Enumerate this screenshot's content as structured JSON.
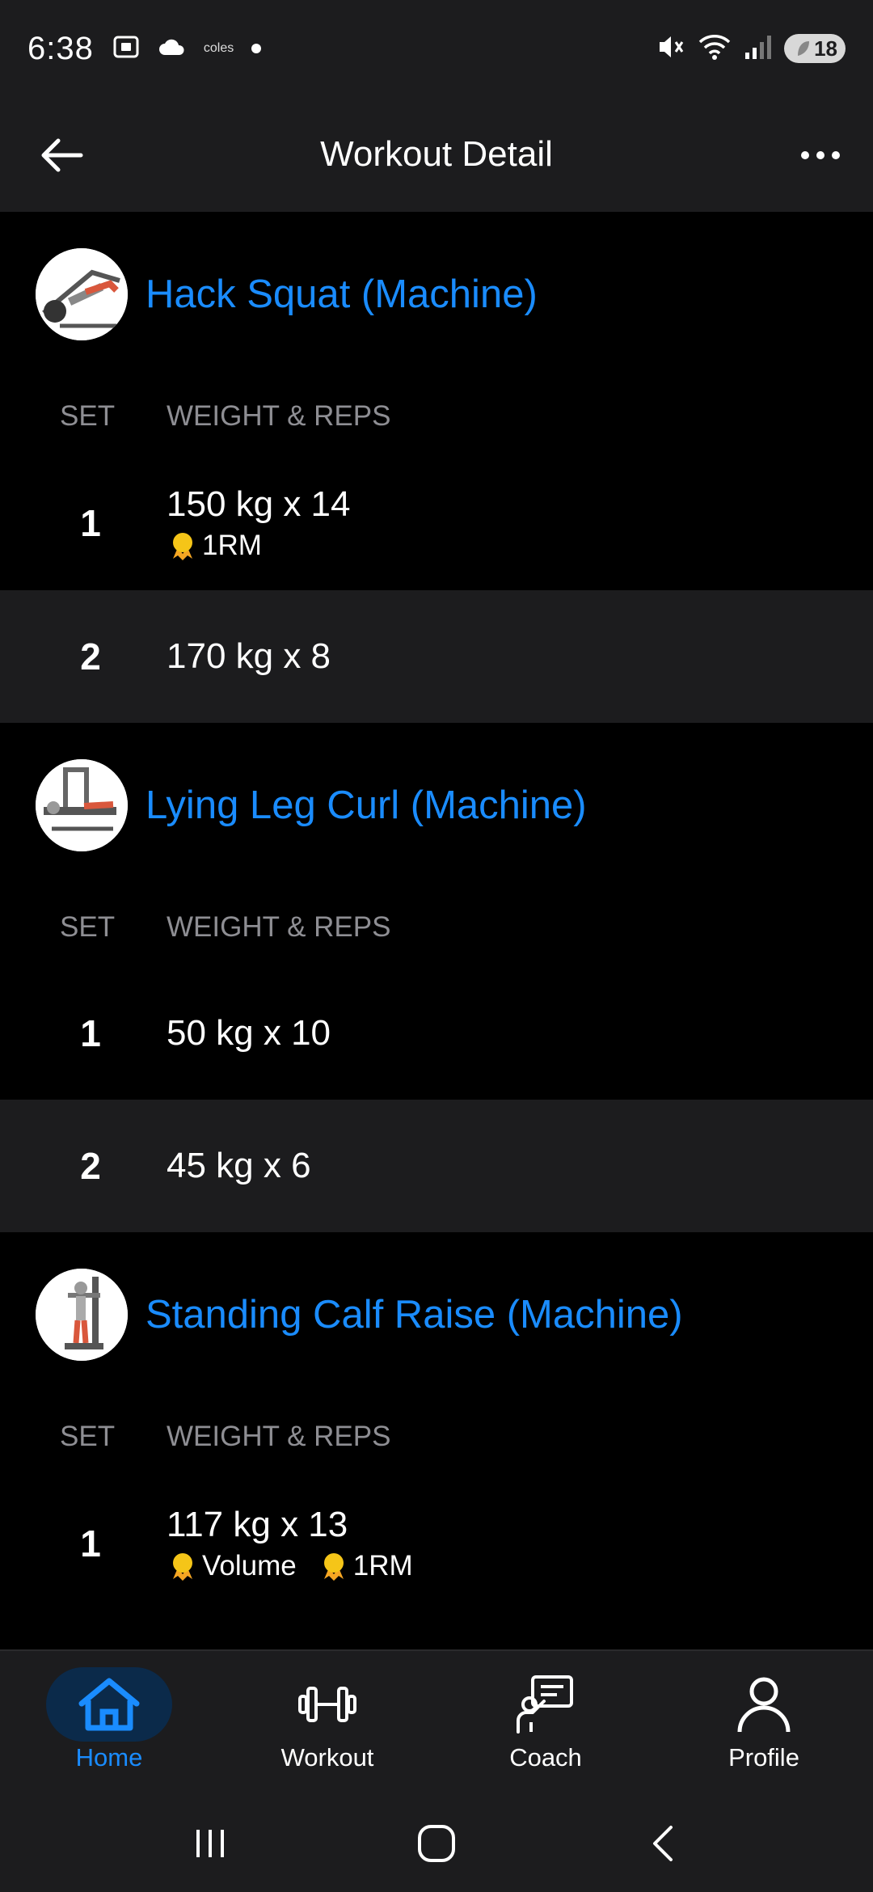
{
  "status_bar": {
    "time": "6:38",
    "app_text": "coles",
    "battery": "18"
  },
  "app_bar": {
    "title": "Workout Detail"
  },
  "column_headers": {
    "set": "SET",
    "weight_reps": "WEIGHT & REPS"
  },
  "exercises": [
    {
      "name": "Hack Squat (Machine)",
      "sets": [
        {
          "num": "1",
          "value": "150 kg x 14",
          "badges": [
            "1RM"
          ]
        },
        {
          "num": "2",
          "value": "170 kg x 8",
          "badges": []
        }
      ]
    },
    {
      "name": "Lying Leg Curl (Machine)",
      "sets": [
        {
          "num": "1",
          "value": "50 kg x 10",
          "badges": []
        },
        {
          "num": "2",
          "value": "45 kg x 6",
          "badges": []
        }
      ]
    },
    {
      "name": "Standing Calf Raise (Machine)",
      "sets": [
        {
          "num": "1",
          "value": "117 kg x 13",
          "badges": [
            "Volume",
            "1RM"
          ]
        }
      ]
    }
  ],
  "bottom_nav": [
    {
      "label": "Home",
      "icon": "home-icon",
      "active": true
    },
    {
      "label": "Workout",
      "icon": "dumbbell-icon",
      "active": false
    },
    {
      "label": "Coach",
      "icon": "coach-icon",
      "active": false
    },
    {
      "label": "Profile",
      "icon": "profile-icon",
      "active": false
    }
  ],
  "colors": {
    "accent": "#1a8cff",
    "background": "#000000",
    "surface": "#1c1c1e",
    "badge_gold": "#f5c518",
    "muted_text": "#8e8e93"
  }
}
